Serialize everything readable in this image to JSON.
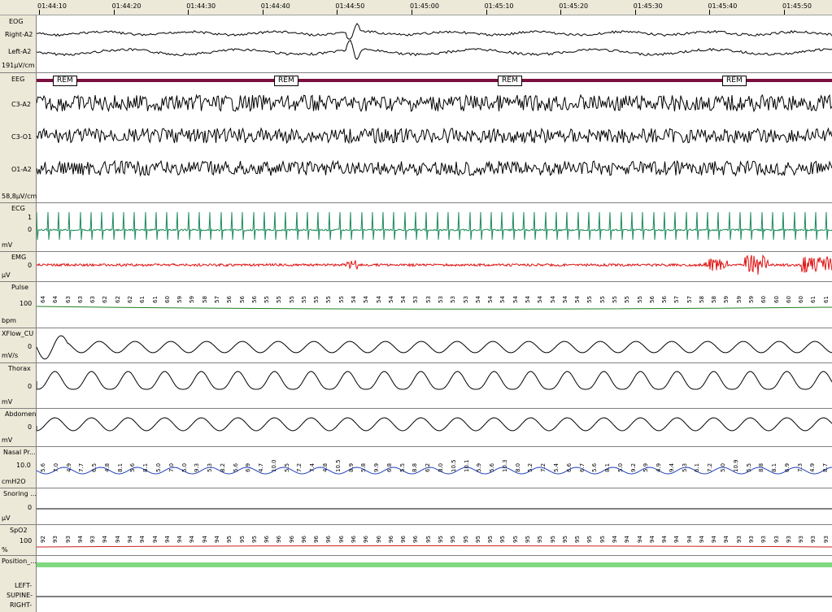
{
  "timeline": {
    "labels": [
      "01:44:10",
      "01:44:20",
      "01:44:30",
      "01:44:40",
      "01:44:50",
      "01:45:00",
      "01:45:10",
      "01:45:20",
      "01:45:30",
      "01:45:40",
      "01:45:50"
    ]
  },
  "channels": {
    "eog": {
      "group": "EOG",
      "right": "Right-A2",
      "left": "Left-A2",
      "scale": "191µV/cm"
    },
    "eeg": {
      "group": "EEG",
      "c3a2": "C3-A2",
      "c3o1": "C3-O1",
      "o1a2": "O1-A2",
      "scale": "58,8µV/cm",
      "stage": "REM"
    },
    "ecg": {
      "label": "ECG",
      "unit": "mV",
      "tick_top": "1",
      "tick_mid": "0"
    },
    "emg": {
      "label": "EMG",
      "unit": "µV",
      "tick": "0"
    },
    "pulse": {
      "label": "Pulse",
      "unit": "bpm",
      "tick": "100",
      "values": [
        "64",
        "64",
        "63",
        "63",
        "63",
        "62",
        "62",
        "62",
        "61",
        "61",
        "60",
        "59",
        "59",
        "58",
        "57",
        "56",
        "56",
        "56",
        "55",
        "55",
        "55",
        "55",
        "55",
        "55",
        "55",
        "54",
        "54",
        "54",
        "54",
        "54",
        "53",
        "53",
        "53",
        "53",
        "53",
        "54",
        "54",
        "54",
        "54",
        "54",
        "54",
        "54",
        "54",
        "54",
        "55",
        "55",
        "55",
        "55",
        "55",
        "56",
        "56",
        "57",
        "57",
        "58",
        "58",
        "59",
        "59",
        "59",
        "60",
        "60",
        "60",
        "60",
        "61",
        "61"
      ]
    },
    "xflow": {
      "label": "XFlow_CU",
      "unit": "mV/s",
      "tick": "0"
    },
    "thorax": {
      "label": "Thorax",
      "unit": "mV",
      "tick": "0"
    },
    "abdomen": {
      "label": "Abdomen",
      "unit": "mV",
      "tick": "0"
    },
    "nasal": {
      "label": "Nasal Pr...",
      "unit": "cmH2O",
      "tick": "10.0",
      "values": [
        "5.6",
        "7.0",
        "4.9",
        "7.7",
        "6.5",
        "4.8",
        "8.1",
        "5.6",
        "8.1",
        "5.0",
        "7.0",
        "5.0",
        "9.3",
        "5.3",
        "8.2",
        "5.6",
        "6.9",
        "4.7",
        "10.0",
        "5.5",
        "7.2",
        "7.4",
        "4.8",
        "10.5",
        "8.9",
        "5.8",
        "9.9",
        "6.8",
        "5.5",
        "8.8",
        "6.2",
        "8.0",
        "10.5",
        "10.1",
        "5.9",
        "5.6",
        "10.3",
        "8.0",
        "5.2",
        "7.2",
        "5.4",
        "6.6",
        "6.7",
        "5.6",
        "8.1",
        "5.0",
        "9.2",
        "5.9",
        "4.9",
        "9.4",
        "5.3",
        "6.1",
        "7.2",
        "5.0",
        "10.9",
        "5.5",
        "8.8",
        "8.1",
        "6.9",
        "7.3",
        "4.9",
        "8.7"
      ]
    },
    "snoring": {
      "label": "Snoring ...",
      "unit": "µV",
      "tick": "0"
    },
    "spo2": {
      "label": "SpO2",
      "unit": "%",
      "tick": "100",
      "values": [
        "92",
        "93",
        "93",
        "94",
        "93",
        "94",
        "94",
        "94",
        "94",
        "94",
        "94",
        "94",
        "94",
        "94",
        "94",
        "95",
        "95",
        "95",
        "96",
        "96",
        "96",
        "96",
        "96",
        "96",
        "96",
        "96",
        "96",
        "96",
        "96",
        "96",
        "96",
        "95",
        "95",
        "95",
        "95",
        "95",
        "95",
        "95",
        "95",
        "95",
        "95",
        "95",
        "95",
        "95",
        "95",
        "95",
        "94",
        "94",
        "94",
        "94",
        "94",
        "94",
        "94",
        "94",
        "94",
        "94",
        "93",
        "93",
        "93",
        "93",
        "93",
        "93",
        "93",
        "93"
      ]
    },
    "position": {
      "label": "Position_...",
      "left": "LEFT-",
      "supine": "SUPINE-",
      "right": "RIGHT-"
    }
  },
  "colors": {
    "ecg": "#1a8a5a",
    "emg": "#e01010",
    "xflow": "#33cc33",
    "nasal": "#2040c0",
    "pulse": "#208020",
    "spo2": "#cc2020",
    "hyp": "#7a1040",
    "position": "#80d880",
    "header_bg": "#ece9d8"
  }
}
